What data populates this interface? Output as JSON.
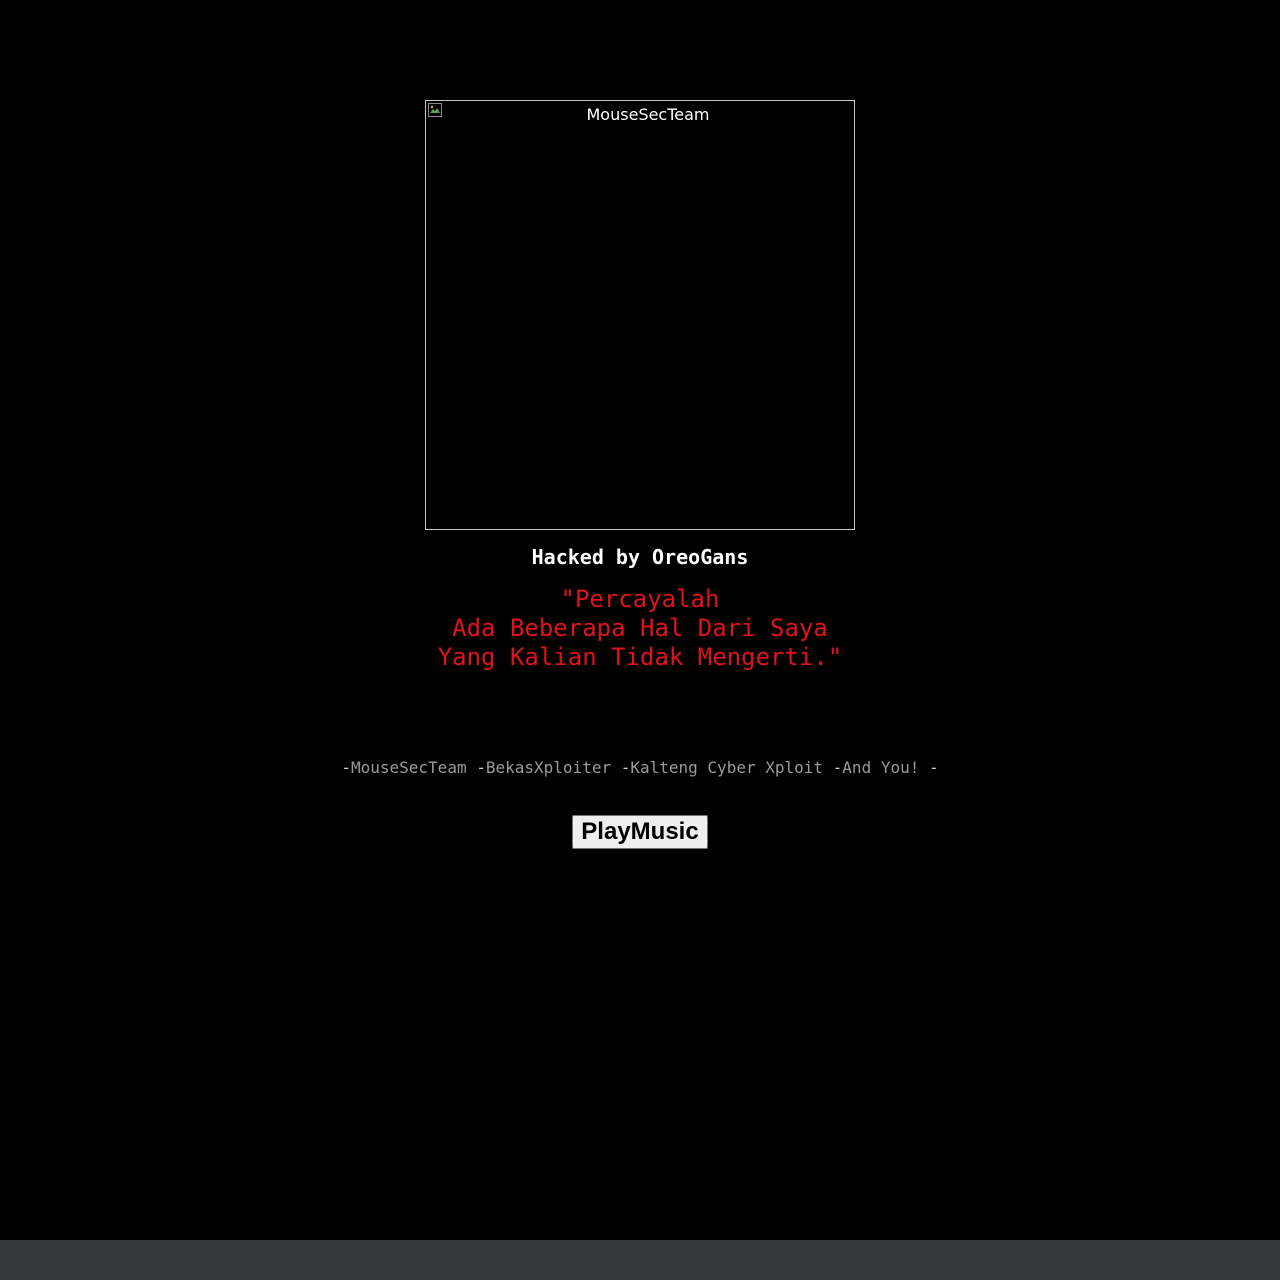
{
  "banner_image": {
    "alt_text": "MouseSecTeam",
    "icon": "broken-image-icon"
  },
  "hacked_by": "Hacked by OreoGans",
  "quote": {
    "line1": "\"Percayalah",
    "line2": "Ada Beberapa Hal Dari Saya",
    "line3": "Yang Kalian Tidak Mengerti.\""
  },
  "greets": [
    {
      "sep": "-",
      "name": "MouseSecTeam "
    },
    {
      "sep": "-",
      "name": "BekasXploiter "
    },
    {
      "sep": "-",
      "name": "Kalteng Cyber Xploit "
    },
    {
      "sep": "-",
      "name": "And You! "
    }
  ],
  "greets_end": "-",
  "play_button": {
    "label": "PlayMusic"
  },
  "colors": {
    "background": "#000000",
    "quote_red": "#e0121b",
    "greets_gray": "#9a9a9a",
    "bottom_bar": "#35383d"
  }
}
